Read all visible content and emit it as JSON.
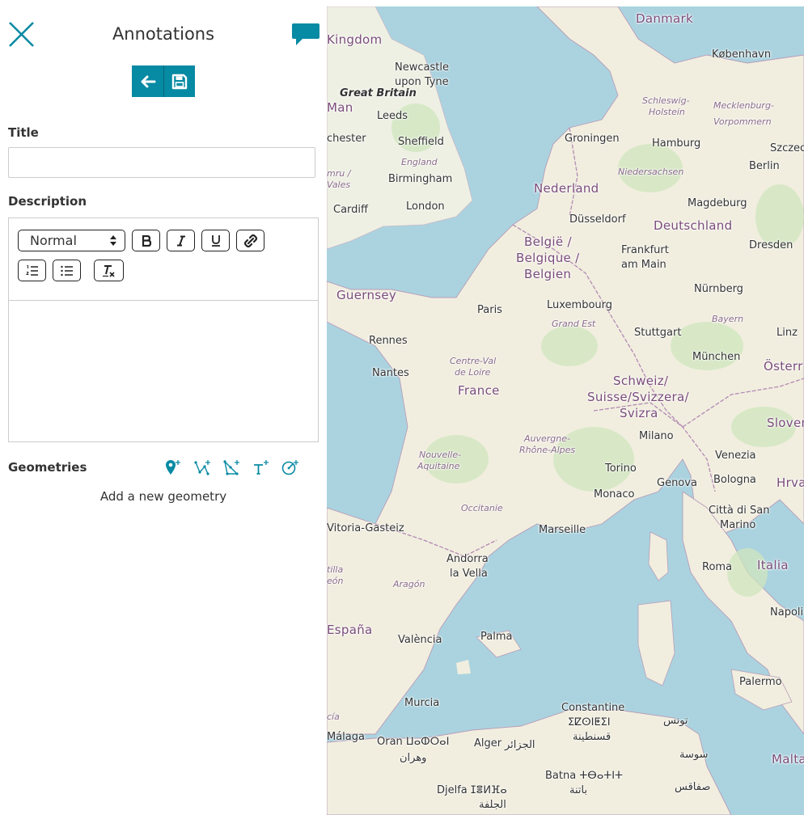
{
  "panel": {
    "title": "Annotations",
    "title_label": "Title",
    "title_value": "",
    "description_label": "Description",
    "editor": {
      "format_select": "Normal",
      "body": ""
    },
    "geometries_label": "Geometries",
    "add_geometry_text": "Add a new geometry",
    "accent_color": "#078aa3"
  },
  "map": {
    "labels": {
      "danmark": "Danmark",
      "kobenhavn": "København",
      "kingdom": "Kingdom",
      "newcastle": "Newcastle",
      "upon_tyne": "upon Tyne",
      "great_britain": "Great Britain",
      "man": "Man",
      "leeds": "Leeds",
      "chester": "chester",
      "sheffield": "Sheffield",
      "england": "England",
      "birmingham": "Birmingham",
      "cymru": "mru /",
      "wales": "Vales",
      "cardiff": "Cardiff",
      "london": "London",
      "schleswig": "Schleswig-",
      "holstein": "Holstein",
      "mecklenburg": "Mecklenburg-",
      "vorpommern": "Vorpommern",
      "groningen": "Groningen",
      "hamburg": "Hamburg",
      "szczecin": "Szczec",
      "niedersachsen": "Niedersachsen",
      "berlin": "Berlin",
      "nederland": "Nederland",
      "magdeburg": "Magdeburg",
      "dusseldorf": "Düsseldorf",
      "deutschland": "Deutschland",
      "dresden": "Dresden",
      "belgie": "België /",
      "belgique": "Belgique /",
      "belgien": "Belgien",
      "frankfurt": "Frankfurt",
      "am_main": "am Main",
      "guernsey": "Guernsey",
      "luxembourg": "Luxembourg",
      "nurnberg": "Nürnberg",
      "paris": "Paris",
      "grand_est": "Grand Est",
      "bayern": "Bayern",
      "stuttgart": "Stuttgart",
      "linz": "Linz",
      "rennes": "Rennes",
      "munchen": "München",
      "centre_val": "Centre-Val",
      "de_loire": "de Loire",
      "osterreich": "Österr",
      "nantes": "Nantes",
      "schweiz": "Schweiz/",
      "suisse": "Suisse/Svizzera/",
      "svizra": "Svizra",
      "france": "France",
      "slovenija": "Sloven",
      "milano": "Milano",
      "auvergne": "Auvergne-",
      "rhone_alpes": "Rhône-Alpes",
      "nouvelle": "Nouvelle-",
      "aquitaine": "Aquitaine",
      "venezia": "Venezia",
      "torino": "Torino",
      "genova": "Genova",
      "bologna": "Bologna",
      "hrvatska": "Hrva",
      "monaco": "Monaco",
      "occitanie": "Occitanie",
      "citta_san": "Città di San",
      "marino": "Marino",
      "vitoria": "Vitoria-Gasteiz",
      "marseille": "Marseille",
      "andorra": "Andorra",
      "la_vella": "la Vella",
      "castilla": "tilla",
      "leon": "eón",
      "aragon": "Aragón",
      "roma": "Roma",
      "italia": "Italia",
      "espana": "España",
      "valencia": "València",
      "palma": "Palma",
      "napoli": "Napoli",
      "palermo": "Palermo",
      "murcia": "Murcia",
      "constantine": "Constantine",
      "constantine_tf": "ⵉⵇⵙⵏⵟⵉⵏ",
      "constantine_ar": "قسنطينة",
      "tunis_ar": "تونس",
      "andalucia": "cía",
      "malaga": "Málaga",
      "oran": "Oran ⵡⴰⵀⵔⴰⵏ",
      "alger": "Alger",
      "alger_ar": "الجزائر",
      "oran_ar": "وهران",
      "sousse": "سوسة",
      "malta": "Malta",
      "batna": "Batna ⵜⴱⴰⵜⵏⵜ",
      "batna_ar": "باتنة",
      "sfax": "صفاقس",
      "djelfa": "Djelfa ⵊⴻⵍⴼⴰ",
      "djelfa_ar": "الجلفة"
    }
  }
}
